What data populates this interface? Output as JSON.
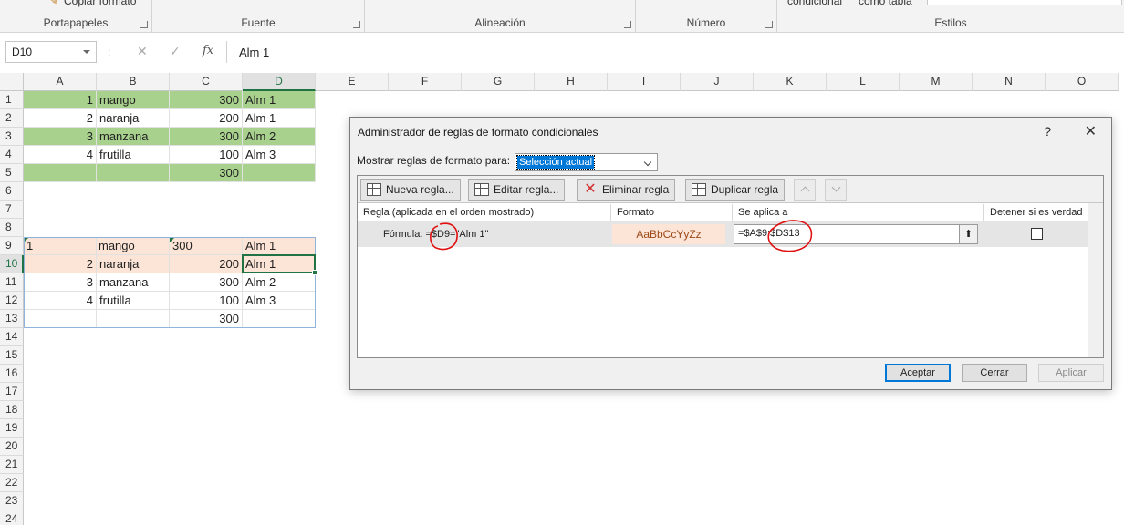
{
  "ribbon": {
    "top_texts": {
      "copiar_formato": "Copiar formato",
      "condicional": "condicional",
      "como_tabla": "como tabla"
    },
    "groups": [
      "Portapapeles",
      "Fuente",
      "Alineación",
      "Número",
      "Estilos"
    ]
  },
  "formula_bar": {
    "name_box": "D10",
    "separator": ":",
    "cancel": "✕",
    "enter": "✓",
    "fx": "fx",
    "content": "Alm 1"
  },
  "columns": [
    "A",
    "B",
    "C",
    "D",
    "E",
    "F",
    "G",
    "H",
    "I",
    "J",
    "K",
    "L",
    "M",
    "N",
    "O"
  ],
  "rows": [
    "1",
    "2",
    "3",
    "4",
    "5",
    "6",
    "7",
    "8",
    "9",
    "10",
    "11",
    "12",
    "13",
    "14",
    "15",
    "16",
    "17",
    "18",
    "19",
    "20",
    "21",
    "22",
    "23",
    "24"
  ],
  "active_cell": {
    "column": "D",
    "row": "10"
  },
  "cells": {
    "r1": [
      "1",
      "mango",
      "300",
      "Alm 1"
    ],
    "r2": [
      "2",
      "naranja",
      "200",
      "Alm 1"
    ],
    "r3": [
      "3",
      "manzana",
      "300",
      "Alm 2"
    ],
    "r4": [
      "4",
      "frutilla",
      "100",
      "Alm 3"
    ],
    "r5": [
      "",
      "",
      "300",
      ""
    ],
    "r9": [
      "1",
      "mango",
      "300",
      "Alm 1"
    ],
    "r10": [
      "2",
      "naranja",
      "200",
      "Alm 1"
    ],
    "r11": [
      "3",
      "manzana",
      "300",
      "Alm 2"
    ],
    "r12": [
      "4",
      "frutilla",
      "100",
      "Alm 3"
    ],
    "r13": [
      "",
      "",
      "300",
      ""
    ]
  },
  "colors": {
    "green_fill": "#a9d18e",
    "peach_fill": "#fce4d6",
    "excel_green": "#217346",
    "accent_blue": "#0078d7",
    "annotation_red": "#e01010"
  },
  "dialog": {
    "title": "Administrador de reglas de formato condicionales",
    "help": "?",
    "close": "✕",
    "show_rules_label": "Mostrar reglas de formato para:",
    "show_rules_value": "Selección actual",
    "toolbar": {
      "new_rule": "Nueva regla...",
      "edit_rule": "Editar regla...",
      "delete_rule": "Eliminar regla",
      "duplicate_rule": "Duplicar regla"
    },
    "table_headers": {
      "rule": "Regla (aplicada en el orden mostrado)",
      "format": "Formato",
      "applies_to": "Se aplica a",
      "stop_if_true": "Detener si es verdad"
    },
    "rule": {
      "formula": "Fórmula: =$D9=\"Alm 1\"",
      "format_preview": "AaBbCcYyZz",
      "applies_to": "=$A$9:$D$13",
      "stop_if_true": false
    },
    "buttons": {
      "accept": "Aceptar",
      "close": "Cerrar",
      "apply": "Aplicar"
    }
  }
}
